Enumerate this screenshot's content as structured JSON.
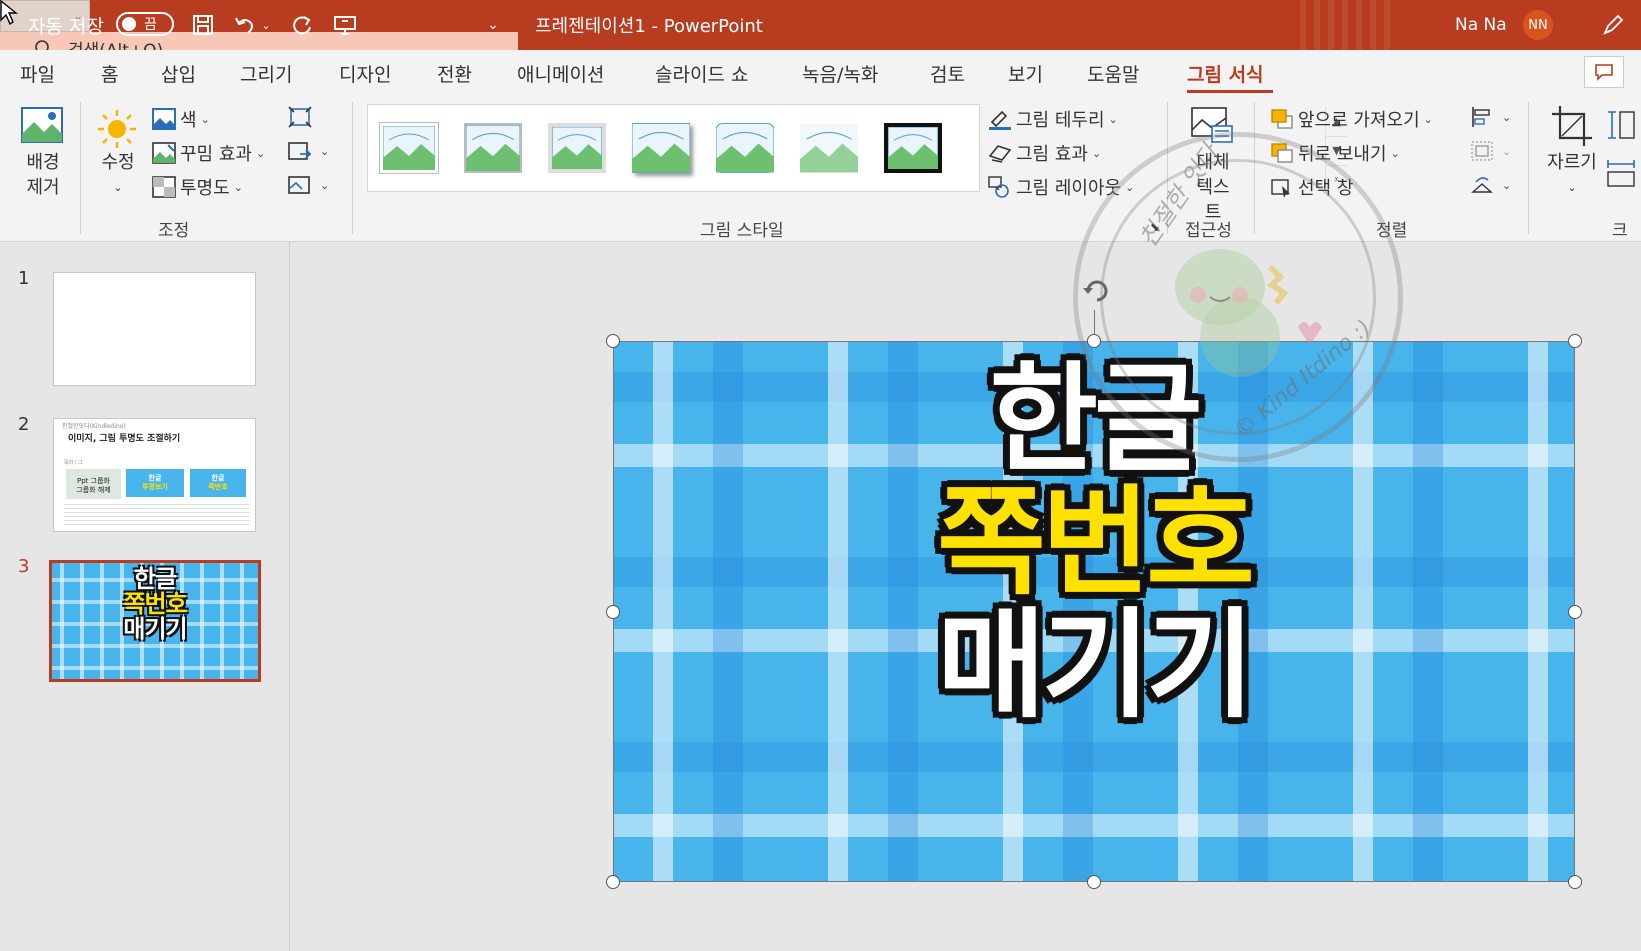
{
  "titlebar": {
    "autosave_label": "자동 저장",
    "autosave_state": "끔",
    "doc_title": "프레젠테이션1  -  PowerPoint",
    "search_placeholder": "검색(Alt+Q)",
    "user_name": "Na Na",
    "user_initials": "NN"
  },
  "menu": {
    "tabs": [
      "파일",
      "홈",
      "삽입",
      "그리기",
      "디자인",
      "전환",
      "애니메이션",
      "슬라이드 쇼",
      "녹음/녹화",
      "검토",
      "보기",
      "도움말",
      "그림 서식"
    ],
    "active_tab": "그림 서식"
  },
  "ribbon": {
    "adjust": {
      "remove_bg": [
        "배경",
        "제거"
      ],
      "corrections": "수정",
      "color": "색",
      "artistic": "꾸밈 효과",
      "transparency": "투명도",
      "group_label": "조정"
    },
    "styles": {
      "group_label": "그림 스타일",
      "border": "그림 테두리",
      "effects": "그림 효과",
      "layout": "그림 레이아웃"
    },
    "accessibility": {
      "alt_text": [
        "대체",
        "텍스트"
      ],
      "group_label": "접근성"
    },
    "arrange": {
      "bring_forward": "앞으로 가져오기",
      "send_backward": "뒤로 보내기",
      "selection_pane": "선택 창",
      "group_label": "정렬"
    },
    "size": {
      "crop": "자르기",
      "group_label": "크기"
    }
  },
  "slides": {
    "numbers": [
      "1",
      "2",
      "3"
    ],
    "selected": "3",
    "thumb2": {
      "header": "친절한잇다(Kindledino)",
      "title": "이미지, 그림 투명도 조절하기",
      "sub": "목차 / 그",
      "col1": [
        "Ppt 그룹화",
        "그룹화 해제"
      ],
      "col2": [
        "한글",
        "투명보기"
      ],
      "col3": [
        "한글",
        "쪽번호"
      ]
    },
    "thumb3": {
      "line1": "한글",
      "line2": "쪽번호",
      "line3": "매기기"
    }
  },
  "slide_image": {
    "line1": "한글",
    "line2": "쪽번호",
    "line3": "매기기"
  },
  "watermark": {
    "top_text": "친절한 잇다",
    "bottom_text": "© Kind Itdino :)"
  },
  "colors": {
    "accent": "#b83d20",
    "plaid_base": "#47b4ec",
    "highlight_yellow": "#ffe100"
  }
}
